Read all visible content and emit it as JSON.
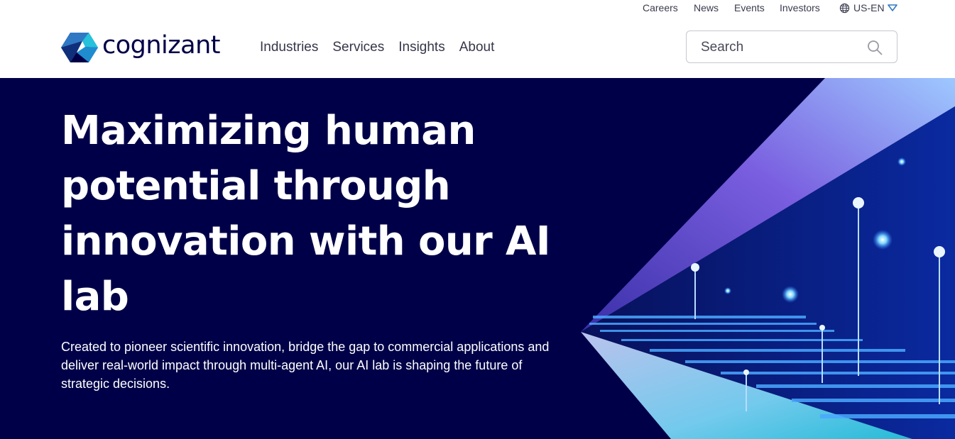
{
  "utility_nav": {
    "careers": "Careers",
    "news": "News",
    "events": "Events",
    "investors": "Investors",
    "language": "US-EN"
  },
  "brand": {
    "name": "cognizant",
    "colors": {
      "navy": "#000048",
      "blue": "#2f78c4",
      "cyan": "#26c1db"
    }
  },
  "main_nav": {
    "industries": "Industries",
    "services": "Services",
    "insights": "Insights",
    "about": "About"
  },
  "search": {
    "placeholder": "Search",
    "icon": "search-icon"
  },
  "hero": {
    "headline": "Maximizing human potential through innovation with our AI lab",
    "subtext": "Created to pioneer scientific innovation, bridge the gap to commercial applications and deliver real-world impact through multi-agent AI, our AI lab is shaping the future of strategic decisions.",
    "background_color": "#000048"
  }
}
